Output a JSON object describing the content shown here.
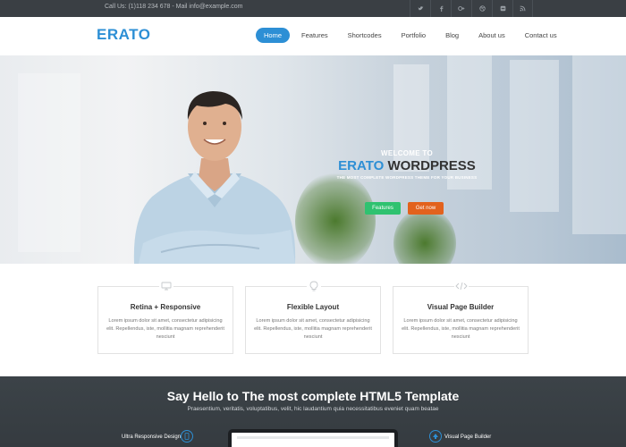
{
  "topbar": {
    "contact": "Call Us: (1)118 234 678 - Mail info@example.com",
    "social_icons": [
      "twitter-icon",
      "facebook-icon",
      "google-plus-icon",
      "dribbble-icon",
      "flickr-icon",
      "rss-icon"
    ]
  },
  "header": {
    "logo": "ERATO",
    "nav": [
      "Home",
      "Features",
      "Shortcodes",
      "Portfolio",
      "Blog",
      "About us",
      "Contact us"
    ],
    "active_nav": "Home"
  },
  "hero": {
    "welcome": "WELCOME TO",
    "title_accent": "ERATO",
    "title_rest": " WORDPRESS",
    "subtitle": "THE MOST COMPLETE WORDPRESS THEME FOR YOUR BUSINESS",
    "btn_features": "Features",
    "btn_getnow": "Get now"
  },
  "features": [
    {
      "title": "Retina + Responsive",
      "text": "Lorem ipsum dolor sit amet, consectetur adipisicing elit. Repellendus, iste, mollitia magnam reprehenderit nesciunt",
      "icon": "monitor-icon"
    },
    {
      "title": "Flexible Layout",
      "text": "Lorem ipsum dolor sit amet, consectetur adipisicing elit. Repellendus, iste, mollitia magnam reprehenderit nesciunt",
      "icon": "lightbulb-icon"
    },
    {
      "title": "Visual Page Builder",
      "text": "Lorem ipsum dolor sit amet, consectetur adipisicing elit. Repellendus, iste, mollitia magnam reprehenderit nesciunt",
      "icon": "code-icon"
    }
  ],
  "promo": {
    "heading": "Say Hello to The most complete HTML5 Template",
    "sub": "Praesentium, veritatis, voluptatibus, velit, hic laudantium quia necessitatibus eveniet quam beatae",
    "left_feature": "Ultra Responsive Design",
    "right_feature": "Visual Page Builder"
  },
  "colors": {
    "accent": "#2d8fd5",
    "green": "#2fc270",
    "orange": "#e2621d",
    "dark": "#3a3f44"
  }
}
